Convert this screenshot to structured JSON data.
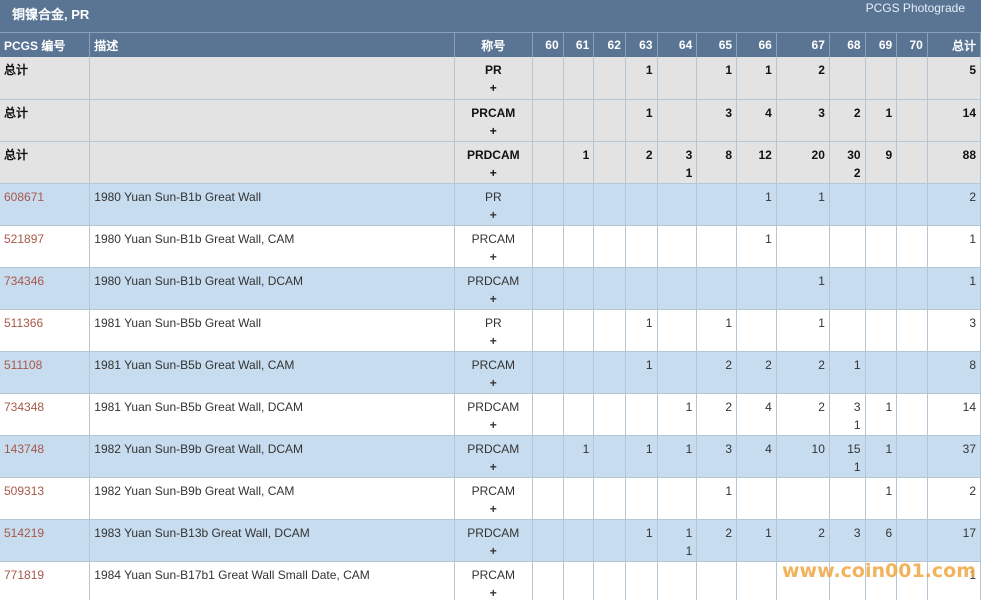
{
  "header": {
    "title": "铜镍合金, PR",
    "brand": "PCGS Photograde"
  },
  "columns": {
    "pcgs_no": "PCGS 编号",
    "desc": "描述",
    "designation": "称号",
    "grades": [
      "60",
      "61",
      "62",
      "63",
      "64",
      "65",
      "66",
      "67",
      "68",
      "69",
      "70"
    ],
    "total": "总计"
  },
  "rows": [
    {
      "kind": "total",
      "pcgs": "总计",
      "desc": "",
      "des": "PR",
      "plus": "+",
      "g": [
        [
          "",
          ""
        ],
        [
          "",
          ""
        ],
        [
          "",
          ""
        ],
        [
          "1",
          ""
        ],
        [
          "",
          ""
        ],
        [
          "1",
          ""
        ],
        [
          "1",
          ""
        ],
        [
          "2",
          ""
        ],
        [
          "",
          ""
        ],
        [
          "",
          ""
        ],
        [
          "",
          ""
        ]
      ],
      "total": "5"
    },
    {
      "kind": "total",
      "pcgs": "总计",
      "desc": "",
      "des": "PRCAM",
      "plus": "+",
      "g": [
        [
          "",
          ""
        ],
        [
          "",
          ""
        ],
        [
          "",
          ""
        ],
        [
          "1",
          ""
        ],
        [
          "",
          ""
        ],
        [
          "3",
          ""
        ],
        [
          "4",
          ""
        ],
        [
          "3",
          ""
        ],
        [
          "2",
          ""
        ],
        [
          "1",
          ""
        ],
        [
          "",
          ""
        ]
      ],
      "total": "14"
    },
    {
      "kind": "total",
      "pcgs": "总计",
      "desc": "",
      "des": "PRDCAM",
      "plus": "+",
      "g": [
        [
          "",
          ""
        ],
        [
          "1",
          ""
        ],
        [
          "",
          ""
        ],
        [
          "2",
          ""
        ],
        [
          "3",
          "1"
        ],
        [
          "8",
          ""
        ],
        [
          "12",
          ""
        ],
        [
          "20",
          ""
        ],
        [
          "30",
          "2"
        ],
        [
          "9",
          ""
        ],
        [
          "",
          ""
        ]
      ],
      "total": "88"
    },
    {
      "kind": "odd",
      "pcgs": "608671",
      "desc": "1980 Yuan Sun-B1b Great Wall",
      "des": "PR",
      "plus": "+",
      "g": [
        [
          "",
          ""
        ],
        [
          "",
          ""
        ],
        [
          "",
          ""
        ],
        [
          "",
          ""
        ],
        [
          "",
          ""
        ],
        [
          "",
          ""
        ],
        [
          "1",
          ""
        ],
        [
          "1",
          ""
        ],
        [
          "",
          ""
        ],
        [
          "",
          ""
        ],
        [
          "",
          ""
        ]
      ],
      "total": "2"
    },
    {
      "kind": "even",
      "pcgs": "521897",
      "desc": "1980 Yuan Sun-B1b Great Wall, CAM",
      "des": "PRCAM",
      "plus": "+",
      "g": [
        [
          "",
          ""
        ],
        [
          "",
          ""
        ],
        [
          "",
          ""
        ],
        [
          "",
          ""
        ],
        [
          "",
          ""
        ],
        [
          "",
          ""
        ],
        [
          "1",
          ""
        ],
        [
          "",
          ""
        ],
        [
          "",
          ""
        ],
        [
          "",
          ""
        ],
        [
          "",
          ""
        ]
      ],
      "total": "1"
    },
    {
      "kind": "odd",
      "pcgs": "734346",
      "desc": "1980 Yuan Sun-B1b Great Wall, DCAM",
      "des": "PRDCAM",
      "plus": "+",
      "g": [
        [
          "",
          ""
        ],
        [
          "",
          ""
        ],
        [
          "",
          ""
        ],
        [
          "",
          ""
        ],
        [
          "",
          ""
        ],
        [
          "",
          ""
        ],
        [
          "",
          ""
        ],
        [
          "1",
          ""
        ],
        [
          "",
          ""
        ],
        [
          "",
          ""
        ],
        [
          "",
          ""
        ]
      ],
      "total": "1"
    },
    {
      "kind": "even",
      "pcgs": "511366",
      "desc": "1981 Yuan Sun-B5b Great Wall",
      "des": "PR",
      "plus": "+",
      "g": [
        [
          "",
          ""
        ],
        [
          "",
          ""
        ],
        [
          "",
          ""
        ],
        [
          "1",
          ""
        ],
        [
          "",
          ""
        ],
        [
          "1",
          ""
        ],
        [
          "",
          ""
        ],
        [
          "1",
          ""
        ],
        [
          "",
          ""
        ],
        [
          "",
          ""
        ],
        [
          "",
          ""
        ]
      ],
      "total": "3"
    },
    {
      "kind": "odd",
      "pcgs": "511108",
      "desc": "1981 Yuan Sun-B5b Great Wall, CAM",
      "des": "PRCAM",
      "plus": "+",
      "g": [
        [
          "",
          ""
        ],
        [
          "",
          ""
        ],
        [
          "",
          ""
        ],
        [
          "1",
          ""
        ],
        [
          "",
          ""
        ],
        [
          "2",
          ""
        ],
        [
          "2",
          ""
        ],
        [
          "2",
          ""
        ],
        [
          "1",
          ""
        ],
        [
          "",
          ""
        ],
        [
          "",
          ""
        ]
      ],
      "total": "8"
    },
    {
      "kind": "even",
      "pcgs": "734348",
      "desc": "1981 Yuan Sun-B5b Great Wall, DCAM",
      "des": "PRDCAM",
      "plus": "+",
      "g": [
        [
          "",
          ""
        ],
        [
          "",
          ""
        ],
        [
          "",
          ""
        ],
        [
          "",
          ""
        ],
        [
          "1",
          ""
        ],
        [
          "2",
          ""
        ],
        [
          "4",
          ""
        ],
        [
          "2",
          ""
        ],
        [
          "3",
          "1"
        ],
        [
          "1",
          ""
        ],
        [
          "",
          ""
        ]
      ],
      "total": "14"
    },
    {
      "kind": "odd",
      "pcgs": "143748",
      "desc": "1982 Yuan Sun-B9b Great Wall, DCAM",
      "des": "PRDCAM",
      "plus": "+",
      "g": [
        [
          "",
          ""
        ],
        [
          "1",
          ""
        ],
        [
          "",
          ""
        ],
        [
          "1",
          ""
        ],
        [
          "1",
          ""
        ],
        [
          "3",
          ""
        ],
        [
          "4",
          ""
        ],
        [
          "10",
          ""
        ],
        [
          "15",
          "1"
        ],
        [
          "1",
          ""
        ],
        [
          "",
          ""
        ]
      ],
      "total": "37"
    },
    {
      "kind": "even",
      "pcgs": "509313",
      "desc": "1982 Yuan Sun-B9b Great Wall, CAM",
      "des": "PRCAM",
      "plus": "+",
      "g": [
        [
          "",
          ""
        ],
        [
          "",
          ""
        ],
        [
          "",
          ""
        ],
        [
          "",
          ""
        ],
        [
          "",
          ""
        ],
        [
          "1",
          ""
        ],
        [
          "",
          ""
        ],
        [
          "",
          ""
        ],
        [
          "",
          ""
        ],
        [
          "1",
          ""
        ],
        [
          "",
          ""
        ]
      ],
      "total": "2"
    },
    {
      "kind": "odd",
      "pcgs": "514219",
      "desc": "1983 Yuan Sun-B13b Great Wall, DCAM",
      "des": "PRDCAM",
      "plus": "+",
      "g": [
        [
          "",
          ""
        ],
        [
          "",
          ""
        ],
        [
          "",
          ""
        ],
        [
          "1",
          ""
        ],
        [
          "1",
          "1"
        ],
        [
          "2",
          ""
        ],
        [
          "1",
          ""
        ],
        [
          "2",
          ""
        ],
        [
          "3",
          ""
        ],
        [
          "6",
          ""
        ],
        [
          "",
          ""
        ]
      ],
      "total": "17"
    },
    {
      "kind": "even",
      "pcgs": "771819",
      "desc": "1984 Yuan Sun-B17b1 Great Wall Small Date, CAM",
      "des": "PRCAM",
      "plus": "+",
      "g": [
        [
          "",
          ""
        ],
        [
          "",
          ""
        ],
        [
          "",
          ""
        ],
        [
          "",
          ""
        ],
        [
          "",
          ""
        ],
        [
          "",
          ""
        ],
        [
          "",
          ""
        ],
        [
          "",
          ""
        ],
        [
          "",
          ""
        ],
        [
          "",
          ""
        ],
        [
          "",
          ""
        ]
      ],
      "total": "1"
    }
  ],
  "watermark": "www.coin001.com"
}
